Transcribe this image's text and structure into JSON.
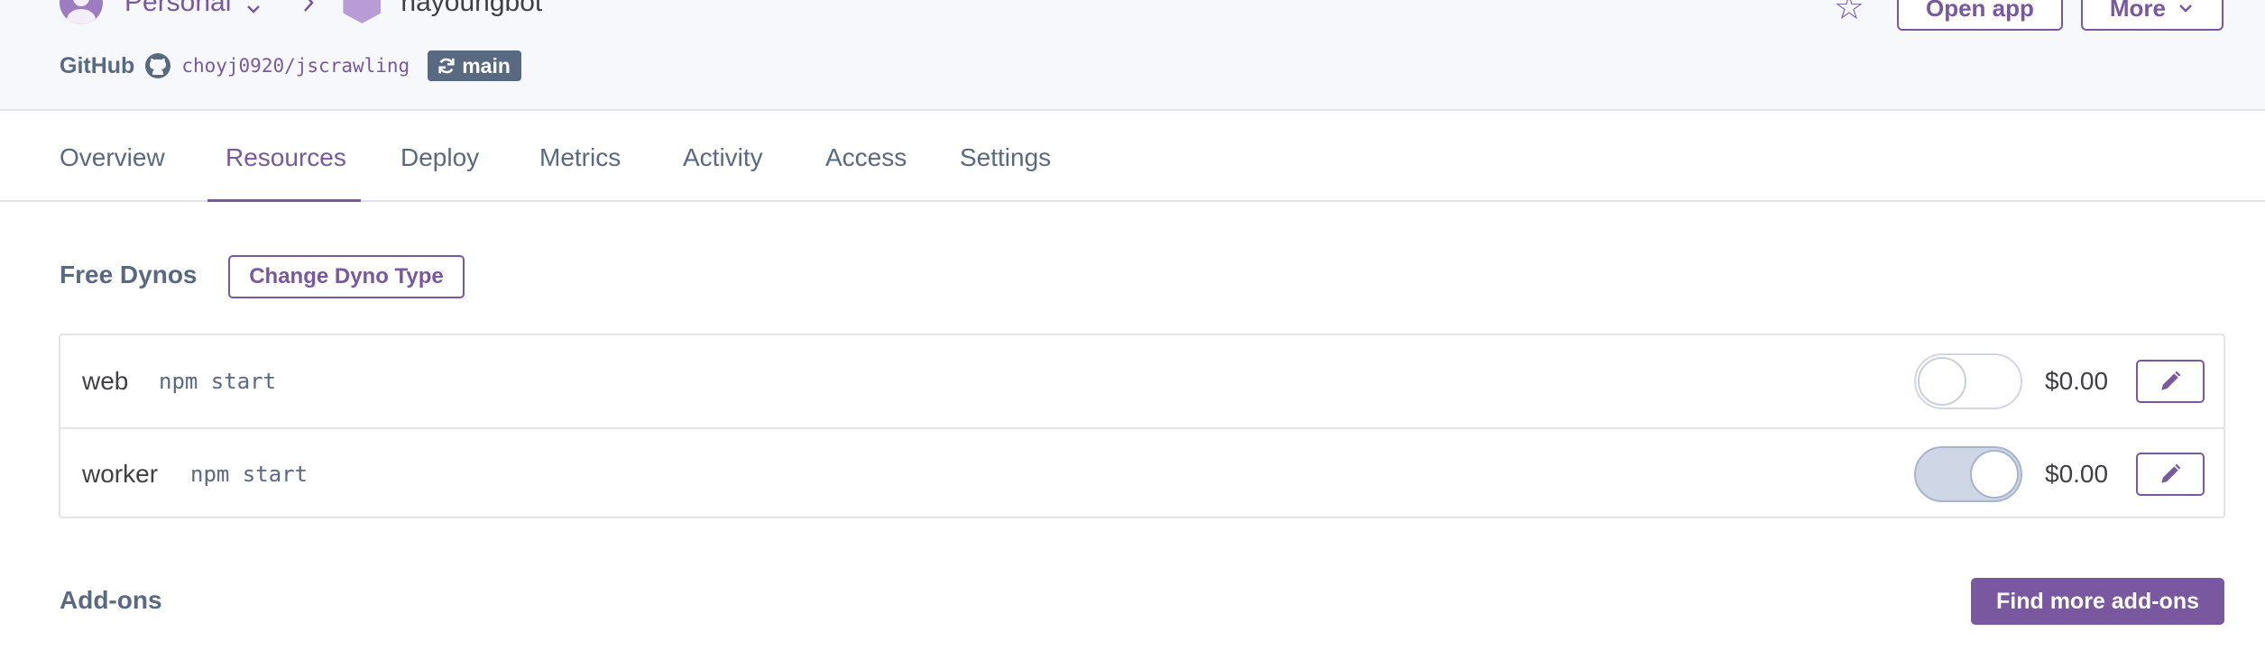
{
  "header": {
    "account": "Personal",
    "app_name": "nayoungbot",
    "open_app_label": "Open app",
    "more_label": "More",
    "github_label": "GitHub",
    "repo": "choyj0920/jscrawling",
    "branch": "main"
  },
  "tabs": [
    "Overview",
    "Resources",
    "Deploy",
    "Metrics",
    "Activity",
    "Access",
    "Settings"
  ],
  "active_tab": "Resources",
  "dynos": {
    "title": "Free Dynos",
    "change_type_label": "Change Dyno Type",
    "items": [
      {
        "name": "web",
        "command": "npm start",
        "enabled": false,
        "price": "$0.00"
      },
      {
        "name": "worker",
        "command": "npm start",
        "enabled": true,
        "price": "$0.00"
      }
    ]
  },
  "addons": {
    "title": "Add-ons",
    "find_more_label": "Find more add-ons"
  },
  "colors": {
    "accent": "#79589f",
    "header_bg": "#f7f8fb",
    "muted": "#596981"
  }
}
